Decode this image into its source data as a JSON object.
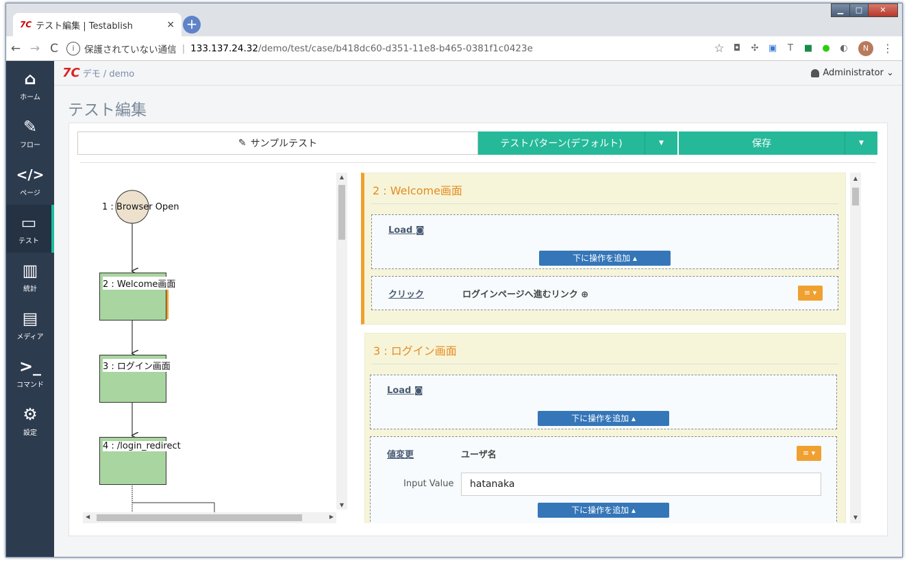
{
  "browser": {
    "tab_favicon": "7C",
    "tab_title": "テスト編集 | Testablish",
    "tab_close": "×",
    "new_tab": "+",
    "win_min": "▁",
    "win_max": "□",
    "win_close": "✕",
    "back": "←",
    "forward": "→",
    "reload": "C",
    "info": "i",
    "insecure_label": "保護されていない通信",
    "url_host": "133.137.24.32",
    "url_path": "/demo/test/case/b418dc60-d351-11e8-b465-0381f1c0423e",
    "bookmark": "☆",
    "profile": "N",
    "more": "⋮"
  },
  "sidebar": {
    "items": [
      {
        "icon": "home-icon",
        "glyph": "⌂",
        "label": "ホーム"
      },
      {
        "icon": "edit-icon",
        "glyph": "✎",
        "label": "フロー"
      },
      {
        "icon": "code-icon",
        "glyph": "</>",
        "label": "ページ"
      },
      {
        "icon": "monitor-icon",
        "glyph": "▭",
        "label": "テスト"
      },
      {
        "icon": "chart-icon",
        "glyph": "▥",
        "label": "統計"
      },
      {
        "icon": "file-icon",
        "glyph": "▤",
        "label": "メディア"
      },
      {
        "icon": "terminal-icon",
        "glyph": ">_",
        "label": "コマンド"
      },
      {
        "icon": "gears-icon",
        "glyph": "⚙",
        "label": "設定"
      }
    ]
  },
  "header": {
    "logo": "7C",
    "breadcrumb": "デモ / demo",
    "user": "Administrator ⌄"
  },
  "page": {
    "title": "テスト編集"
  },
  "toolbar": {
    "sample_test": "サンプルテスト",
    "sample_icon": "✎",
    "pattern": "テストパターン(デフォルト)",
    "save": "保存",
    "caret": "▼"
  },
  "flow": {
    "node1": "1 : Browser Open",
    "node2": "2 : Welcome画面",
    "node3": "3 : ログイン画面",
    "node4": "4 : /login_redirect"
  },
  "detail": {
    "sections": [
      {
        "title": "2 : Welcome画面",
        "load_label": "Load",
        "add_below": "下に操作を追加 ▴",
        "op_name": "クリック",
        "op_target": "ログインページへ進むリンク ⊕",
        "menu": "≡ ▾"
      },
      {
        "title": "3 : ログイン画面",
        "load_label": "Load",
        "add_below": "下に操作を追加 ▴",
        "op_name": "値変更",
        "op_target": "ユーザ名",
        "menu": "≡ ▾",
        "input_label": "Input Value",
        "input_value": "hatanaka",
        "add_below2": "下に操作を追加 ▴"
      }
    ]
  }
}
